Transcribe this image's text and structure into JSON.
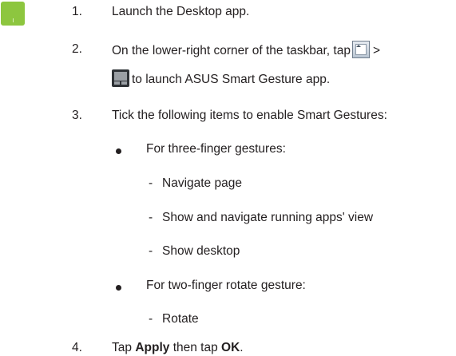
{
  "steps": [
    {
      "number": "1.",
      "text": "Launch the Desktop app."
    },
    {
      "number": "2.",
      "line1": "On the lower-right corner of the taskbar, tap",
      "separator": ">",
      "line2": "to launch ASUS Smart Gesture app."
    },
    {
      "number": "3.",
      "text": "Tick the following items to enable Smart Gestures:"
    },
    {
      "number": "4.",
      "prefix": "Tap",
      "bold1": "Apply",
      "middle": "then tap",
      "bold2": "OK",
      "suffix": "."
    }
  ],
  "groups": [
    {
      "heading": "For three-finger gestures:",
      "items": [
        "Navigate page",
        "Show and navigate running apps' view",
        "Show desktop"
      ]
    },
    {
      "heading": "For two-finger rotate gesture:",
      "items": [
        "Rotate"
      ]
    }
  ],
  "dash": "-",
  "icons": {
    "tray": "show-hidden-icons-arrow-icon",
    "app": "asus-smart-gesture-icon"
  },
  "colors": {
    "accent": "#8dc63f",
    "text": "#231f20"
  }
}
